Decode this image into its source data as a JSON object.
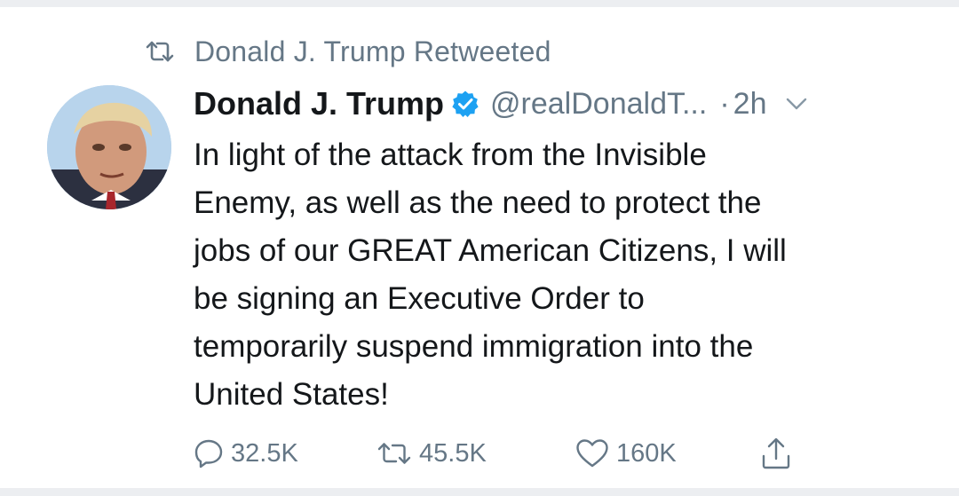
{
  "retweet_context": {
    "label": "Donald J. Trump Retweeted",
    "icon": "retweet-icon"
  },
  "tweet": {
    "author_name": "Donald J. Trump",
    "verified": true,
    "handle": "@realDonaldT...",
    "separator": "·",
    "time": "2h",
    "avatar_icon": "avatar",
    "text_lines": [
      "In light of the attack from the Invisible",
      "Enemy, as well as the need to protect the",
      "jobs of our GREAT American Citizens, I will",
      "be signing an Executive Order to",
      "temporarily suspend immigration into the",
      "United States!"
    ]
  },
  "actions": {
    "replies": "32.5K",
    "retweets": "45.5K",
    "likes": "160K"
  },
  "colors": {
    "text": "#14171a",
    "secondary": "#657786",
    "verified_blue": "#1da1f2",
    "background": "#ffffff"
  }
}
